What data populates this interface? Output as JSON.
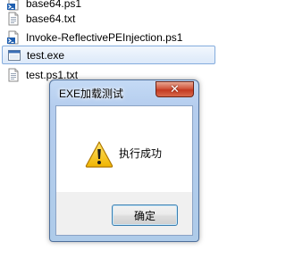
{
  "file_list": {
    "items": [
      {
        "name": "base64.ps1",
        "icon": "powershell-script-icon"
      },
      {
        "name": "base64.txt",
        "icon": "text-document-icon"
      },
      {
        "name": "Invoke-ReflectivePEInjection.ps1",
        "icon": "powershell-script-icon"
      },
      {
        "name": "test.exe",
        "icon": "application-icon",
        "selected": true
      },
      {
        "name": "test.ps1.txt",
        "icon": "text-document-icon"
      }
    ]
  },
  "dialog": {
    "title": "EXE加载测试",
    "close_symbol": "✕",
    "message": "执行成功",
    "icon": "warning-icon",
    "ok_label": "确定"
  },
  "colors": {
    "selection_border": "#84acdd",
    "close_button": "#c33a22",
    "warning_yellow": "#f5c400"
  }
}
